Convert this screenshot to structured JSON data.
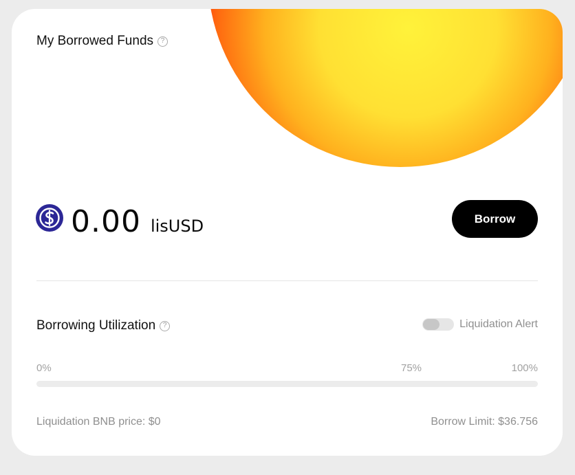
{
  "card": {
    "title": "My Borrowed Funds",
    "help_glyph": "?"
  },
  "balance": {
    "icon": "lisusd-token-icon",
    "amount": "0.00",
    "unit": "lisUSD"
  },
  "actions": {
    "borrow_label": "Borrow"
  },
  "utilization": {
    "title": "Borrowing Utilization",
    "help_glyph": "?",
    "alert_label": "Liquidation Alert",
    "alert_enabled": false,
    "ticks": [
      "0%",
      "75%",
      "100%"
    ],
    "progress": 0
  },
  "footer": {
    "liquidation_price": "Liquidation BNB price: $0",
    "borrow_limit": "Borrow Limit: $36.756"
  },
  "colors": {
    "token_icon": "#2c2796",
    "button_bg": "#000000",
    "accent_glow": "#ff6a10"
  }
}
